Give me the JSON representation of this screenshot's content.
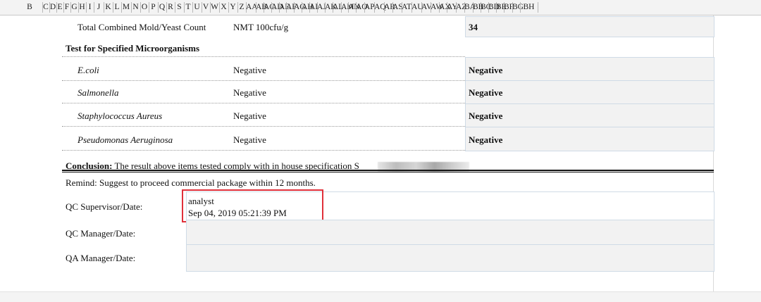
{
  "column_headers": [
    "B",
    "C",
    "D",
    "E",
    "F",
    "G",
    "H",
    "I",
    "J",
    "K",
    "L",
    "M",
    "N",
    "O",
    "P",
    "Q",
    "R",
    "S",
    "T",
    "U",
    "V",
    "W",
    "X",
    "Y",
    "Z",
    "AA",
    "AB",
    "AC",
    "AD",
    "AE",
    "AF",
    "AG",
    "AH",
    "AI",
    "AJ",
    "AK",
    "AL",
    "AM",
    "AN",
    "AO",
    "AP",
    "AQ",
    "AR",
    "AS",
    "AT",
    "AU",
    "AV",
    "AW",
    "AX",
    "AY",
    "AZ",
    "BA",
    "BB",
    "BC",
    "BD",
    "BE",
    "BF",
    "BG",
    "BH"
  ],
  "report": {
    "mold_label": "Total Combined Mold/Yeast Count",
    "mold_spec": "NMT 100cfu/g",
    "mold_result": "34",
    "section_title": "Test for Specified Microorganisms",
    "rows": [
      {
        "name": "E.coli",
        "spec": "Negative",
        "result": "Negative"
      },
      {
        "name": "Salmonella",
        "spec": "Negative",
        "result": "Negative"
      },
      {
        "name": "Staphylococcus Aureus",
        "spec": "Negative",
        "result": "Negative"
      },
      {
        "name": "Pseudomonas Aeruginosa",
        "spec": "Negative",
        "result": "Negative"
      }
    ],
    "conclusion_label": "Conclusion:",
    "conclusion_text": "The result above items tested comply with in house specification S",
    "remind": "Remind: Suggest to proceed commercial package within 12 months.",
    "qc_supervisor_label": "QC Supervisor/Date:",
    "qc_supervisor_name": "analyst",
    "qc_supervisor_date": "Sep 04, 2019 05:21:39 PM",
    "qc_manager_label": "QC Manager/Date:",
    "qa_manager_label": "QA Manager/Date:"
  }
}
